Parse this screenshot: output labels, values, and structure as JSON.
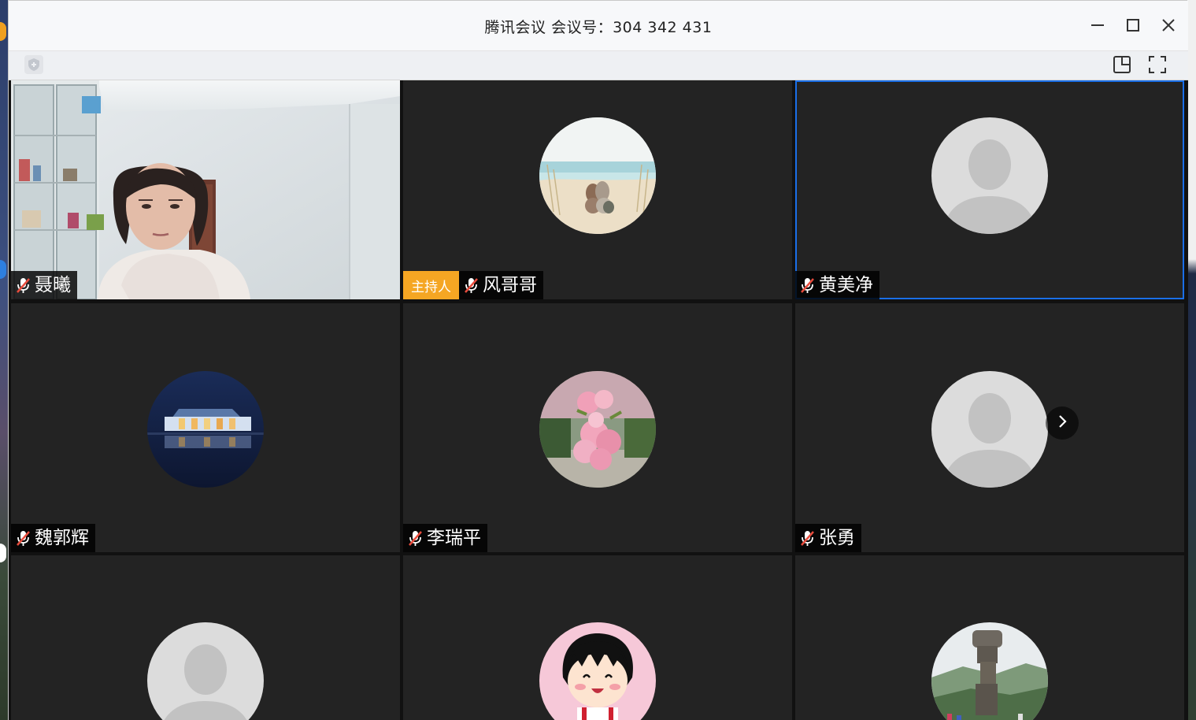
{
  "window": {
    "title": "腾讯会议 会议号：304 342 431"
  },
  "icons": {
    "minimize": "minimize-icon",
    "maximize": "maximize-icon",
    "close": "close-icon",
    "security": "shield-icon",
    "layout": "layout-icon",
    "fullscreen": "fullscreen-icon",
    "mic_muted": "mic-muted-icon",
    "next_page": "chevron-right-icon"
  },
  "host_badge": "主持人",
  "participants": [
    {
      "name": "聂曦",
      "type": "camera",
      "muted": true
    },
    {
      "name": "风哥哥",
      "type": "avatar-beach",
      "muted": true,
      "host": true
    },
    {
      "name": "黄美净",
      "type": "avatar-default",
      "muted": true,
      "active": true
    },
    {
      "name": "魏郭辉",
      "type": "avatar-building",
      "muted": true
    },
    {
      "name": "李瑞平",
      "type": "avatar-flowers",
      "muted": true
    },
    {
      "name": "张勇",
      "type": "avatar-default",
      "muted": true
    },
    {
      "name": "",
      "type": "avatar-default"
    },
    {
      "name": "",
      "type": "avatar-cartoon"
    },
    {
      "name": "",
      "type": "avatar-rock"
    }
  ],
  "colors": {
    "host_badge": "#f5a623",
    "active_border": "#1a6fe8",
    "tile_bg": "#232323",
    "mic_muted": "#e84c3d"
  }
}
